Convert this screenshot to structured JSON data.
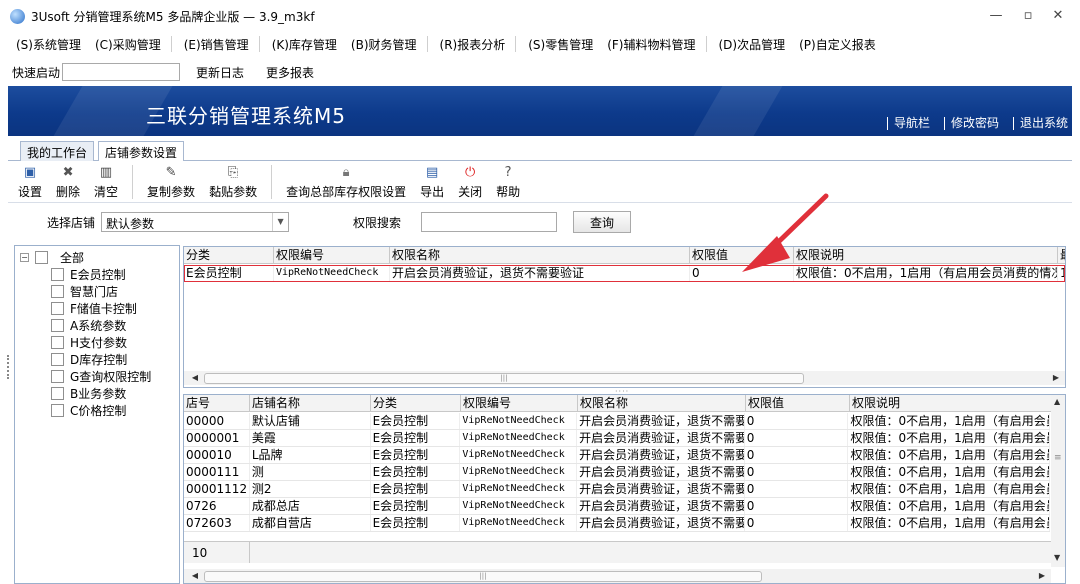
{
  "window": {
    "title": "3Usoft 分销管理系统M5 多品牌企业版 — 3.9_m3kf"
  },
  "menu": [
    {
      "label": "(S)系统管理"
    },
    {
      "label": "(C)采购管理"
    },
    {
      "label": "(E)销售管理"
    },
    {
      "label": "(K)库存管理"
    },
    {
      "label": "(B)财务管理"
    },
    {
      "label": "(R)报表分析"
    },
    {
      "label": "(S)零售管理"
    },
    {
      "label": "(F)辅料物料管理"
    },
    {
      "label": "(D)次品管理"
    },
    {
      "label": "(P)自定义报表"
    }
  ],
  "quickbar": {
    "label": "快速启动",
    "input_value": "",
    "link1": "更新日志",
    "link2": "更多报表"
  },
  "banner": {
    "title": "三联分销管理系统M5",
    "nav": "导航栏",
    "change_password": "修改密码",
    "logout": "退出系统"
  },
  "tabs": [
    {
      "label": "我的工作台"
    },
    {
      "label": "店铺参数设置"
    }
  ],
  "toolbar": {
    "save": "设置",
    "delete": "删除",
    "clear": "清空",
    "copy": "复制参数",
    "paste": "黏贴参数",
    "query_perm": "查询总部库存权限设置",
    "export": "导出",
    "close": "关闭",
    "help": "帮助"
  },
  "filter": {
    "store_label": "选择店铺",
    "store_value": "默认参数",
    "search_label": "权限搜索",
    "search_value": "",
    "query_button": "查询"
  },
  "tree": {
    "root": "全部",
    "items": [
      "E会员控制",
      "智慧门店",
      "F储值卡控制",
      "A系统参数",
      "H支付参数",
      "D库存控制",
      "G查询权限控制",
      "B业务参数",
      "C价格控制"
    ]
  },
  "upper_grid": {
    "columns": [
      "分类",
      "权限编号",
      "权限名称",
      "权限值",
      "权限说明",
      "最"
    ],
    "rows": [
      [
        "E会员控制",
        "VipReNotNeedCheck",
        "开启会员消费验证，退货不需要验证",
        "0",
        "权限值：0不启用，1启用（有启用会员消费的情况",
        "1"
      ]
    ]
  },
  "lower_grid": {
    "columns": [
      "店号",
      "店铺名称",
      "分类",
      "权限编号",
      "权限名称",
      "权限值",
      "权限说明"
    ],
    "rows": [
      [
        "00000",
        "默认店铺",
        "E会员控制",
        "VipReNotNeedCheck",
        "开启会员消费验证，退货不需要",
        "0",
        "权限值：0不启用，1启用（有启用会员"
      ],
      [
        "0000001",
        "美霞",
        "E会员控制",
        "VipReNotNeedCheck",
        "开启会员消费验证，退货不需要",
        "0",
        "权限值：0不启用，1启用（有启用会员"
      ],
      [
        "000010",
        "L品牌",
        "E会员控制",
        "VipReNotNeedCheck",
        "开启会员消费验证，退货不需要",
        "0",
        "权限值：0不启用，1启用（有启用会员"
      ],
      [
        "0000111",
        "测",
        "E会员控制",
        "VipReNotNeedCheck",
        "开启会员消费验证，退货不需要",
        "0",
        "权限值：0不启用，1启用（有启用会员"
      ],
      [
        "00001112",
        "测2",
        "E会员控制",
        "VipReNotNeedCheck",
        "开启会员消费验证，退货不需要",
        "0",
        "权限值：0不启用，1启用（有启用会员"
      ],
      [
        "0726",
        "成都总店",
        "E会员控制",
        "VipReNotNeedCheck",
        "开启会员消费验证，退货不需要",
        "0",
        "权限值：0不启用，1启用（有启用会员"
      ],
      [
        "072603",
        "成都自营店",
        "E会员控制",
        "VipReNotNeedCheck",
        "开启会员消费验证，退货不需要",
        "0",
        "权限值：0不启用，1启用（有启用会员"
      ]
    ],
    "footer_count": "10"
  },
  "colors": {
    "banner": "#0d3a8b",
    "annotation": "#e0303a",
    "border": "#9bb0cc"
  }
}
